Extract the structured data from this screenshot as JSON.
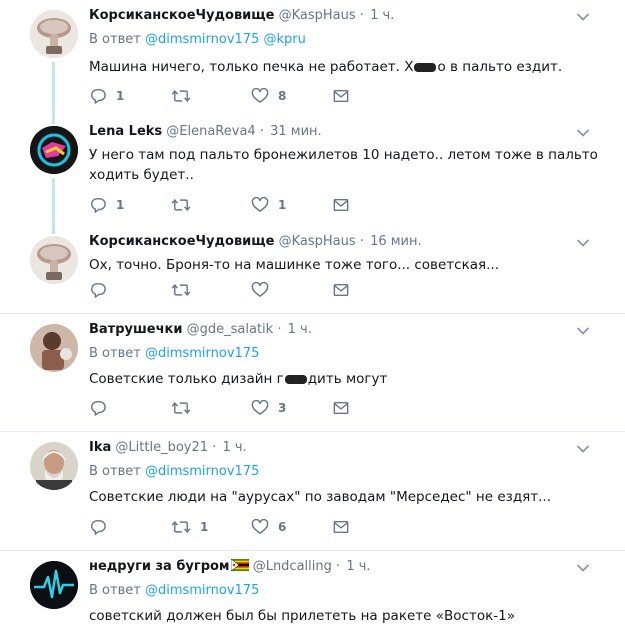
{
  "reply_prefix": "В ответ",
  "tweets": [
    {
      "name": "КорсиканскоеЧудовище",
      "handle": "@KaspHaus",
      "time": "1 ч.",
      "reply_to": [
        "@dimsmirnov175",
        "@kpru"
      ],
      "text_before": "Машина ничего, только печка не работает. Х",
      "text_after": "о в пальто ездит.",
      "replies": "1",
      "retweets": "",
      "likes": "8"
    },
    {
      "name": "Lena Leks",
      "handle": "@ElenaReva4",
      "time": "31 мин.",
      "text": "У него там под пальто бронежилетов 10 надето.. летом тоже в пальто ходить будет..",
      "replies": "1",
      "retweets": "",
      "likes": "1"
    },
    {
      "name": "КорсиканскоеЧудовище",
      "handle": "@KaspHaus",
      "time": "16 мин.",
      "text": "Ох, точно. Броня-то на машинке тоже того... советская...",
      "replies": "",
      "retweets": "",
      "likes": ""
    },
    {
      "name": "Ватрушечки",
      "handle": "@gde_salatik",
      "time": "1 ч.",
      "reply_to": [
        "@dimsmirnov175"
      ],
      "text_before": "Советские только дизайн г",
      "text_after": "дить могут",
      "replies": "",
      "retweets": "",
      "likes": "3"
    },
    {
      "name": "Ika",
      "handle": "@Little_boy21",
      "time": "1 ч.",
      "reply_to": [
        "@dimsmirnov175"
      ],
      "text": "Советские люди на \"аурусах\" по заводам \"Мерседес\" не ездят...",
      "replies": "",
      "retweets": "1",
      "likes": "6"
    },
    {
      "name": "недруги за бугром",
      "handle": "@Lndcalling",
      "time": "1 ч.",
      "reply_to": [
        "@dimsmirnov175"
      ],
      "text": "советский должен был бы прилететь на ракете «Восток-1»",
      "replies": "",
      "retweets": "",
      "likes": ""
    }
  ],
  "colors": {
    "link": "#1da1f2",
    "secondary": "#657786",
    "thread_line": "#c4e3f7",
    "divider": "#e6ecf0"
  },
  "icons": {
    "reply": "reply-icon",
    "retweet": "retweet-icon",
    "like": "heart-icon",
    "dm": "envelope-icon",
    "menu": "chevron-down-icon",
    "flag": "zimbabwe-flag-icon"
  }
}
